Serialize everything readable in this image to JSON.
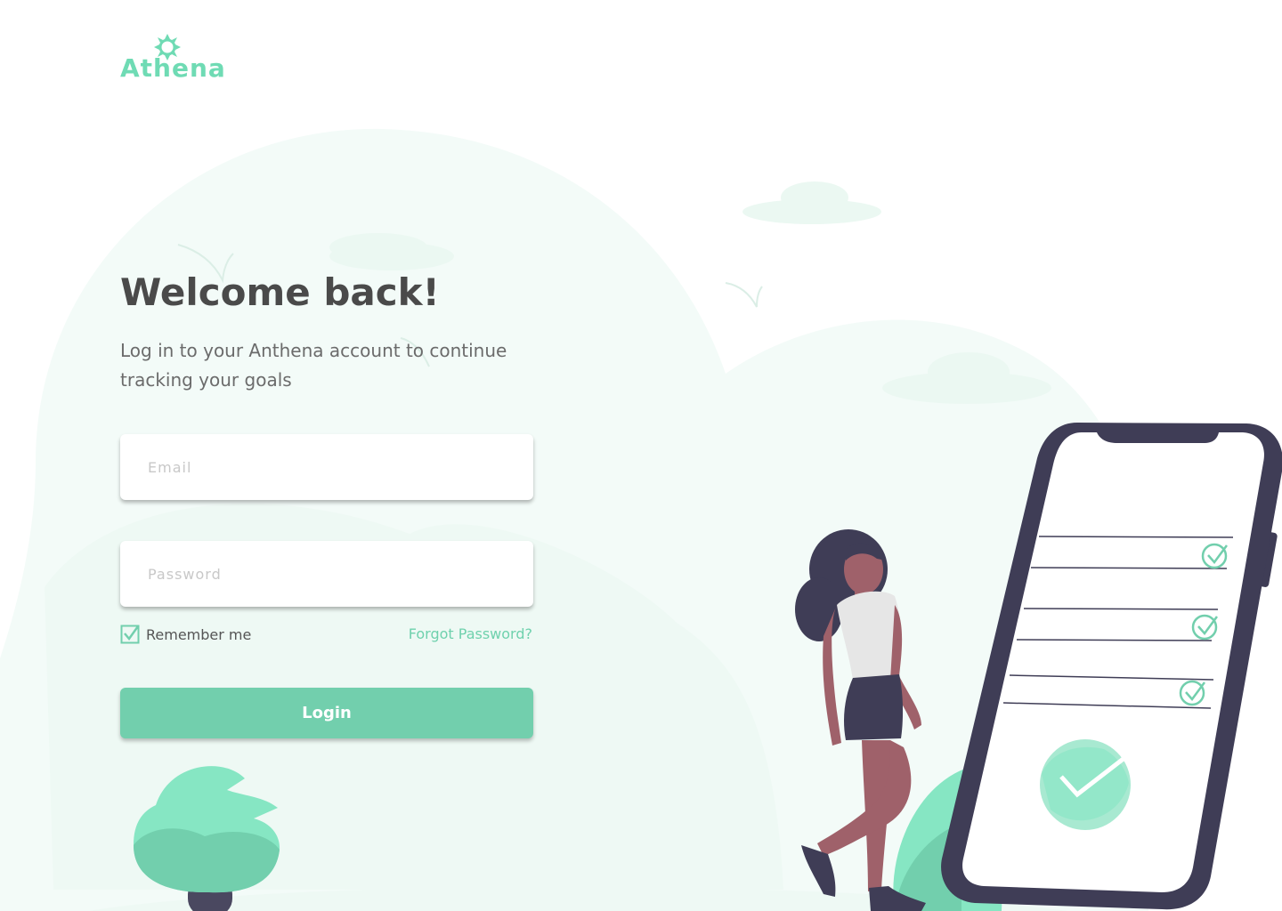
{
  "brand": {
    "name": "Athena",
    "logo_icon": "sun-icon"
  },
  "page": {
    "title": "Welcome back!",
    "subtitle": "Log in to your Anthena account to continue tracking your goals"
  },
  "form": {
    "email_placeholder": "Email",
    "email_value": "",
    "password_placeholder": "Password",
    "password_value": "",
    "remember_label": "Remember me",
    "remember_checked": true,
    "forgot_label": "Forgot Password?",
    "login_label": "Login"
  },
  "illustration": {
    "description_icons": [
      "woman-figure-icon",
      "smartphone-icon",
      "checklist-icon",
      "tree-icon",
      "plant-icon",
      "cloud-icon",
      "bird-icon"
    ]
  },
  "colors": {
    "accent": "#72cfad",
    "accent_light": "#86e6c3",
    "title": "#4a4a4a",
    "text": "#6b6b6b",
    "phone_frame": "#3f3d56",
    "background_blob": "#f2fbf7"
  }
}
